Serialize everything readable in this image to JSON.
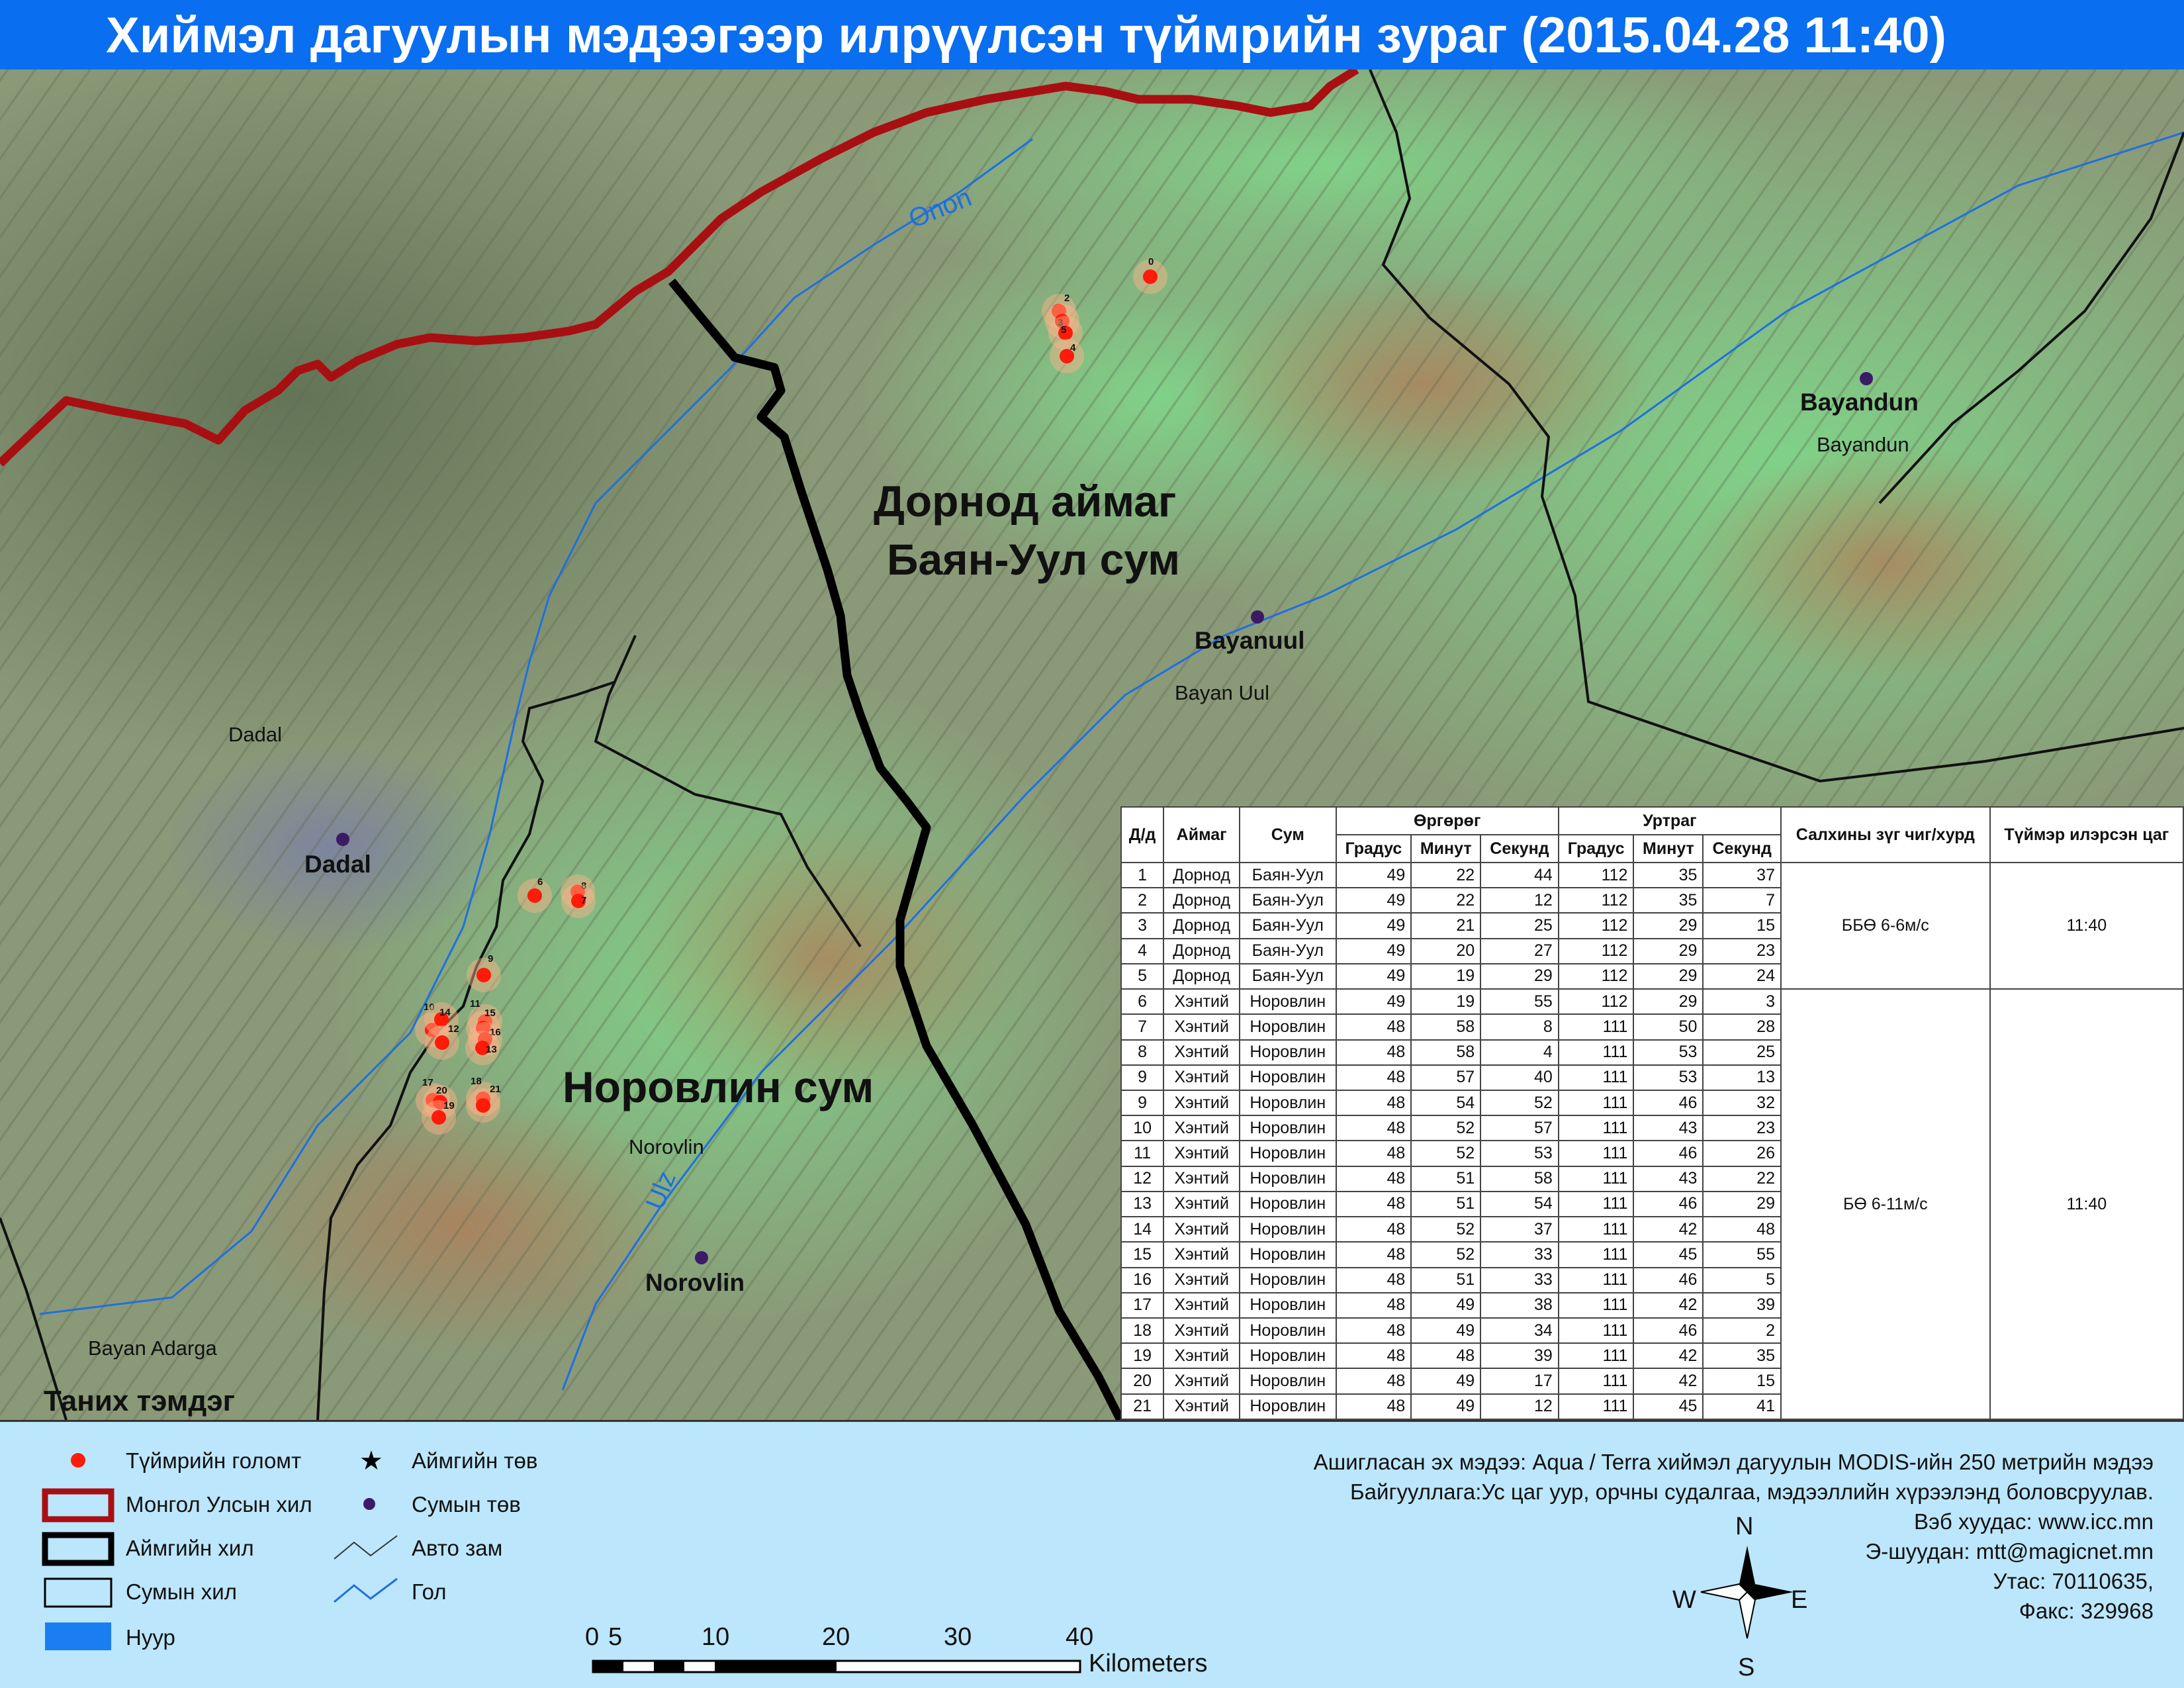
{
  "title": "Хиймэл дагуулын мэдээгээр илрүүлсэн түймрийн зураг  (2015.04.28 11:40)",
  "map_labels": {
    "region1_line1": "Дорнод аймаг",
    "region1_line2": "Баян-Уул сум",
    "region2": "Норовлин сум",
    "river_onon": "Onon",
    "river_ulz": "Ulz",
    "bayandun_bold": "Bayandun",
    "bayandun": "Bayandun",
    "bayanuul_bold": "Bayanuul",
    "bayanuul": "Bayan Uul",
    "dadal_plain": "Dadal",
    "dadal_bold": "Dadal",
    "norovlin_plain": "Norovlin",
    "norovlin_bold": "Norovlin",
    "bayan_adarga": "Bayan Adarga"
  },
  "fire_points": [
    {
      "id": "0"
    },
    {
      "id": "2"
    },
    {
      "id": "3"
    },
    {
      "id": "5"
    },
    {
      "id": "4"
    },
    {
      "id": "6"
    },
    {
      "id": "8"
    },
    {
      "id": "7"
    },
    {
      "id": "9"
    },
    {
      "id": "10"
    },
    {
      "id": "14"
    },
    {
      "id": "12"
    },
    {
      "id": "11"
    },
    {
      "id": "15"
    },
    {
      "id": "16"
    },
    {
      "id": "13"
    },
    {
      "id": "17"
    },
    {
      "id": "20"
    },
    {
      "id": "19"
    },
    {
      "id": "18"
    },
    {
      "id": "21"
    }
  ],
  "table": {
    "headers": {
      "dd": "Д/д",
      "aimag": "Аймаг",
      "sum": "Сум",
      "lat": "Өргөрөг",
      "lon": "Уртраг",
      "deg": "Градус",
      "min": "Минут",
      "sec": "Секунд",
      "wind": "Салхины зүг чиг/хурд",
      "time": "Түймэр илэрсэн цаг"
    },
    "rows": [
      [
        "1",
        "Дорнод",
        "Баян-Уул",
        "49",
        "22",
        "44",
        "112",
        "35",
        "37"
      ],
      [
        "2",
        "Дорнод",
        "Баян-Уул",
        "49",
        "22",
        "12",
        "112",
        "35",
        "7"
      ],
      [
        "3",
        "Дорнод",
        "Баян-Уул",
        "49",
        "21",
        "25",
        "112",
        "29",
        "15"
      ],
      [
        "4",
        "Дорнод",
        "Баян-Уул",
        "49",
        "20",
        "27",
        "112",
        "29",
        "23"
      ],
      [
        "5",
        "Дорнод",
        "Баян-Уул",
        "49",
        "19",
        "29",
        "112",
        "29",
        "24"
      ],
      [
        "6",
        "Хэнтий",
        "Норовлин",
        "49",
        "19",
        "55",
        "112",
        "29",
        "3"
      ],
      [
        "7",
        "Хэнтий",
        "Норовлин",
        "48",
        "58",
        "8",
        "111",
        "50",
        "28"
      ],
      [
        "8",
        "Хэнтий",
        "Норовлин",
        "48",
        "58",
        "4",
        "111",
        "53",
        "25"
      ],
      [
        "9",
        "Хэнтий",
        "Норовлин",
        "48",
        "57",
        "40",
        "111",
        "53",
        "13"
      ],
      [
        "9",
        "Хэнтий",
        "Норовлин",
        "48",
        "54",
        "52",
        "111",
        "46",
        "32"
      ],
      [
        "10",
        "Хэнтий",
        "Норовлин",
        "48",
        "52",
        "57",
        "111",
        "43",
        "23"
      ],
      [
        "11",
        "Хэнтий",
        "Норовлин",
        "48",
        "52",
        "53",
        "111",
        "46",
        "26"
      ],
      [
        "12",
        "Хэнтий",
        "Норовлин",
        "48",
        "51",
        "58",
        "111",
        "43",
        "22"
      ],
      [
        "13",
        "Хэнтий",
        "Норовлин",
        "48",
        "51",
        "54",
        "111",
        "46",
        "29"
      ],
      [
        "14",
        "Хэнтий",
        "Норовлин",
        "48",
        "52",
        "37",
        "111",
        "42",
        "48"
      ],
      [
        "15",
        "Хэнтий",
        "Норовлин",
        "48",
        "52",
        "33",
        "111",
        "45",
        "55"
      ],
      [
        "16",
        "Хэнтий",
        "Норовлин",
        "48",
        "51",
        "33",
        "111",
        "46",
        "5"
      ],
      [
        "17",
        "Хэнтий",
        "Норовлин",
        "48",
        "49",
        "38",
        "111",
        "42",
        "39"
      ],
      [
        "18",
        "Хэнтий",
        "Норовлин",
        "48",
        "49",
        "34",
        "111",
        "46",
        "2"
      ],
      [
        "19",
        "Хэнтий",
        "Норовлин",
        "48",
        "48",
        "39",
        "111",
        "42",
        "35"
      ],
      [
        "20",
        "Хэнтий",
        "Норовлин",
        "48",
        "49",
        "17",
        "111",
        "42",
        "15"
      ],
      [
        "21",
        "Хэнтий",
        "Норовлин",
        "48",
        "49",
        "12",
        "111",
        "45",
        "41"
      ]
    ],
    "group1": {
      "wind": "ББӨ 6-6м/с",
      "time": "11:40"
    },
    "group2": {
      "wind": "БӨ 6-11м/с",
      "time": "11:40"
    }
  },
  "legend": {
    "title": "Таних тэмдэг",
    "fire": "Түймрийн голомт",
    "country_border": "Монгол Улсын хил",
    "aimag_border": "Аймгийн хил",
    "sum_border": "Сумын хил",
    "lake": "Нуур",
    "aimag_center": "Аймгийн төв",
    "sum_center": "Сумын төв",
    "road": "Авто зам",
    "river": "Гол"
  },
  "scale": {
    "ticks": [
      "0",
      "5",
      "10",
      "20",
      "30",
      "40"
    ],
    "unit": "Kilometers"
  },
  "compass": {
    "n": "N",
    "s": "S",
    "e": "E",
    "w": "W"
  },
  "credits": [
    "Ашигласан эх мэдээ: Aqua / Terra хиймэл дагуулын MODIS-ийн 250 метрийн мэдээ",
    "Байгууллага:Ус цаг уур, орчны судалгаа, мэдээллийн хүрээлэнд боловсруулав.",
    "Вэб хуудас: www.icc.mn",
    "Э-шуудан: mtt@magicnet.mn",
    "Утас: 70110635,",
    "Факс: 329968"
  ],
  "colors": {
    "title_bg": "#0a6ef0",
    "fire": "#ff1a0a",
    "country_border": "#a80f12",
    "sum_center": "#3d1a66",
    "river": "#1f6fe0",
    "legend_bg": "#bce6fb",
    "lake": "#1a7ef2"
  }
}
